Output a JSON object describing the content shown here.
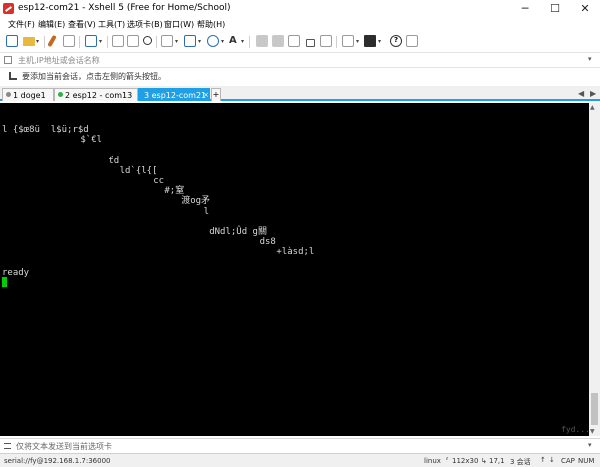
{
  "window": {
    "title": "esp12-com21 - Xshell 5 (Free for Home/School)",
    "minimize_glyph": "─",
    "maximize_glyph": "☐",
    "close_glyph": "✕"
  },
  "menu": [
    "文件(F)",
    "编辑(E)",
    "查看(V)",
    "工具(T)",
    "选项卡(B)",
    "窗口(W)",
    "帮助(H)"
  ],
  "toolbar": {
    "icons": [
      "new-session-icon",
      "open-folder-icon",
      "pen-icon",
      "connect-icon",
      "disconnect-icon",
      "copy-icon",
      "find-icon",
      "print-icon",
      "transfer-icon",
      "globe-icon",
      "font-icon",
      "scripts-icon",
      "lock-icon",
      "keyboard-icon",
      "compose-icon",
      "layout-icon",
      "help-icon",
      "command-window-icon"
    ],
    "help_glyph": "?"
  },
  "address_bar": {
    "placeholder": "主机,IP地址或会话名称",
    "dropdown_glyph": "▾"
  },
  "hint_bar": {
    "text": "要添加当前会话，点击左侧的箭头按钮。"
  },
  "tabs": [
    {
      "label": "1 doge1",
      "active": false,
      "dot_color": "#888888"
    },
    {
      "label": "2 esp12 - com13",
      "active": false,
      "dot_color": "#2db14a"
    },
    {
      "label": "3 esp12-com21",
      "active": true,
      "dot_color": "#ffffff"
    }
  ],
  "tab_close_glyph": "×",
  "tab_add_glyph": "+",
  "tab_nav": {
    "left": "◀",
    "right": "▶"
  },
  "terminal": {
    "lines": [
      {
        "text": "l {$œ8ü  l$ü;r$d",
        "col": 0,
        "row": 0
      },
      {
        "text": "$`€l",
        "col": 14,
        "row": 1
      },
      {
        "text": "ťd",
        "col": 19,
        "row": 3
      },
      {
        "text": "ld`{l{[",
        "col": 21,
        "row": 4
      },
      {
        "text": "cc",
        "col": 27,
        "row": 5
      },
      {
        "text": "#;窒",
        "col": 29,
        "row": 6
      },
      {
        "text": "渡og矛",
        "col": 32,
        "row": 7
      },
      {
        "text": "l",
        "col": 36,
        "row": 8
      },
      {
        "text": "dNdl;Ûd g關",
        "col": 37,
        "row": 10
      },
      {
        "text": "ds8",
        "col": 46,
        "row": 11
      },
      {
        "text": "+làsd;l",
        "col": 49,
        "row": 12
      },
      {
        "text": "ready",
        "col": 0,
        "row": 14
      }
    ],
    "watermark": "fyd..."
  },
  "scrollbar": {
    "up": "▲",
    "down": "▼"
  },
  "send_bar": {
    "placeholder": "仅将文本发送到当前选项卡",
    "dropdown_glyph": "▾"
  },
  "status_bar": {
    "connection": "serial://fy@192.168.1.7:36000",
    "terminal_type": "linux",
    "size": "112x30",
    "cursor_pos": "17,1",
    "sessions": "3 会话",
    "up_arrow": "↑",
    "down_arrow": "↓",
    "caps": "CAP",
    "num": "NUM",
    "size_prefix": "⸢",
    "pos_prefix": "↳"
  },
  "colors": {
    "tab_active": "#1f9fe5",
    "terminal_bg": "#000000",
    "terminal_fg": "#d8d8d8",
    "cursor": "#00d000"
  }
}
